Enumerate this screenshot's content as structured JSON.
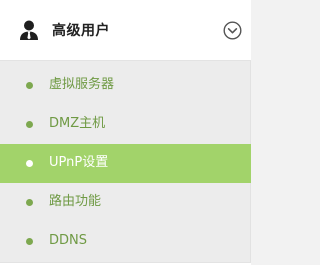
{
  "panel": {
    "title": "高级用户",
    "icons": {
      "user": "user-icon",
      "toggle": "chevron-down-circle-icon"
    },
    "items": [
      {
        "label": "虚拟服务器",
        "active": false
      },
      {
        "label": "DMZ主机",
        "active": false
      },
      {
        "label": "UPnP设置",
        "active": true
      },
      {
        "label": "路由功能",
        "active": false
      },
      {
        "label": "DDNS",
        "active": false
      }
    ]
  },
  "colors": {
    "accent": "#a2d36a",
    "item_text": "#6f9a44",
    "dot": "#7da84f"
  }
}
